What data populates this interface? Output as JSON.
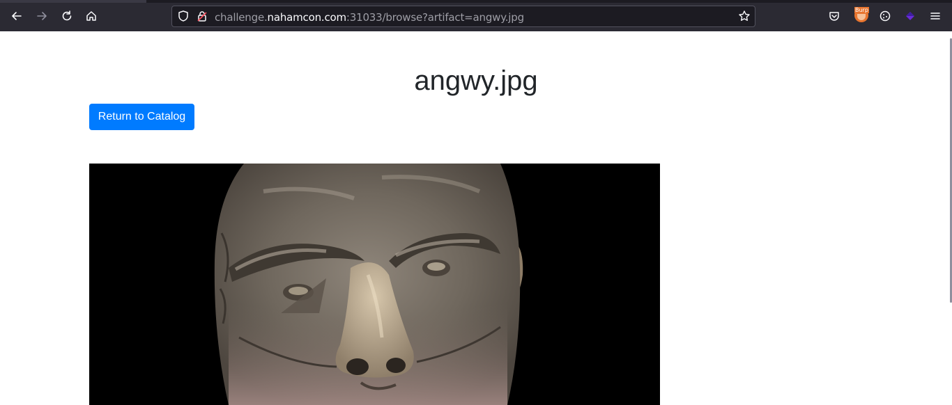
{
  "browser": {
    "url_prefix": "challenge.",
    "url_host": "nahamcon.com",
    "url_rest": ":31033/browse?artifact=angwy.jpg",
    "extension_badge": "Burp"
  },
  "page": {
    "title": "angwy.jpg",
    "return_button": "Return to Catalog",
    "primary_color": "#007bff"
  },
  "image": {
    "alt": "angwy.jpg"
  }
}
